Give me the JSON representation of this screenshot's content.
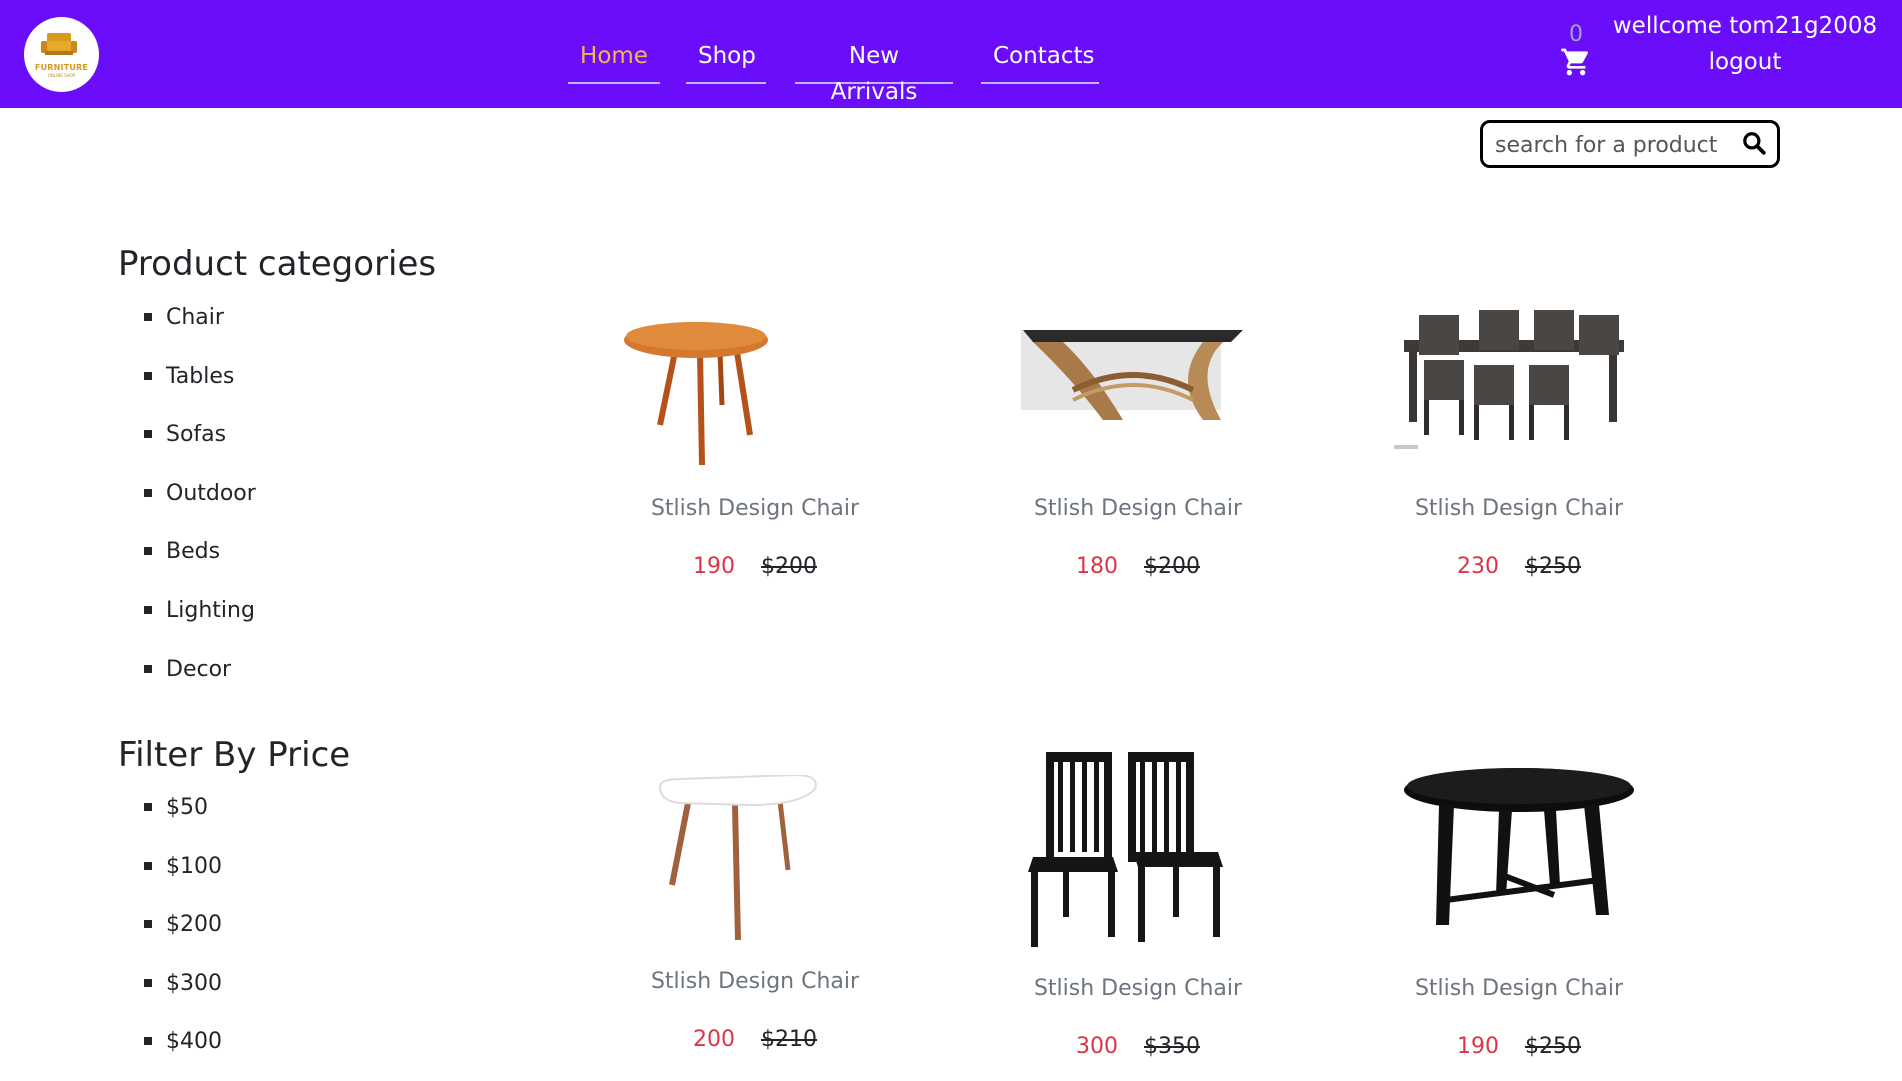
{
  "brand": {
    "logo_text": "FURNITURE",
    "logo_subtext": "ONLINE SHOP"
  },
  "nav": {
    "items": [
      {
        "label": "Home",
        "active": true
      },
      {
        "label": "Shop",
        "active": false
      },
      {
        "label": "New Arrivals",
        "active": false
      },
      {
        "label": "Contacts",
        "active": false
      }
    ]
  },
  "cart": {
    "count": "0",
    "icon": "cart-icon"
  },
  "user": {
    "welcome": "wellcome tom21g2008",
    "logout": "logout"
  },
  "search": {
    "placeholder": "search for a product",
    "value": "",
    "icon": "search-icon"
  },
  "sidebar": {
    "categories_title": "Product categories",
    "categories": [
      "Chair",
      "Tables",
      "Sofas",
      "Outdoor",
      "Beds",
      "Lighting",
      "Decor"
    ],
    "price_title": "Filter By Price",
    "prices": [
      "$50",
      "$100",
      "$200",
      "$300",
      "$400"
    ]
  },
  "products": [
    {
      "name": "Stlish Design Chair",
      "price": "190",
      "old_price": "$200",
      "image": "round-wood-table"
    },
    {
      "name": "Stlish Design Chair",
      "price": "180",
      "old_price": "$200",
      "image": "glass-coffee-table"
    },
    {
      "name": "Stlish Design Chair",
      "price": "230",
      "old_price": "$250",
      "image": "dining-table-set"
    },
    {
      "name": "Stlish Design Chair",
      "price": "200",
      "old_price": "$210",
      "image": "white-side-table"
    },
    {
      "name": "Stlish Design Chair",
      "price": "300",
      "old_price": "$350",
      "image": "black-chairs"
    },
    {
      "name": "Stlish Design Chair",
      "price": "190",
      "old_price": "$250",
      "image": "black-round-table"
    }
  ],
  "colors": {
    "header": "#6a0dfa",
    "nav_active": "#f6b54c",
    "price": "#dc3545",
    "product_name": "#6c757d"
  }
}
